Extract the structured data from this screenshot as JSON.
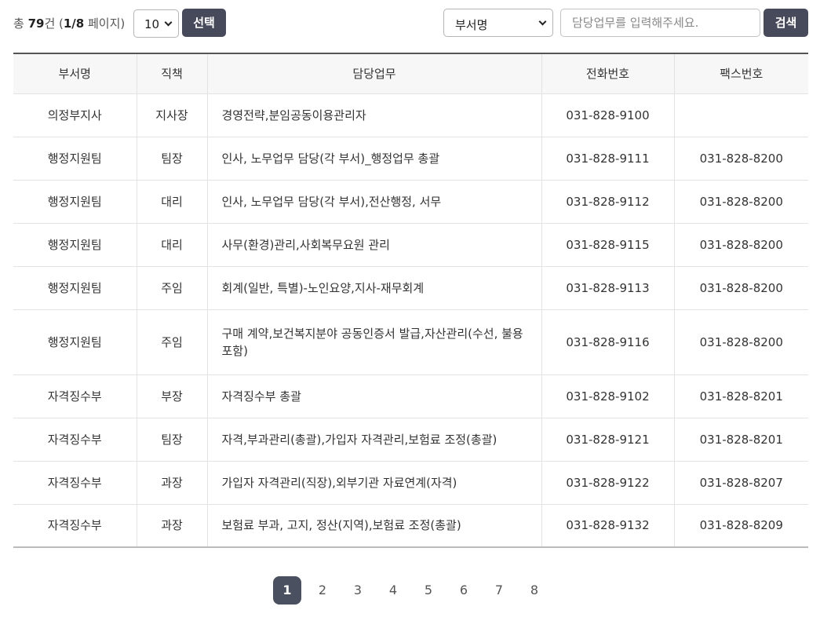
{
  "summary": {
    "prefix": "총 ",
    "total": "79",
    "unit": "건 (",
    "page": "1/8",
    "suffix": " 페이지)"
  },
  "page_size": {
    "value": "10"
  },
  "select_button": "선택",
  "dept_select": {
    "value": "부서명"
  },
  "search": {
    "placeholder": "담당업무를 입력해주세요.",
    "value": ""
  },
  "search_button": "검색",
  "table": {
    "headers": [
      "부서명",
      "직책",
      "담당업무",
      "전화번호",
      "팩스번호"
    ],
    "rows": [
      [
        "의정부지사",
        "지사장",
        "경영전략,분임공동이용관리자",
        "031-828-9100",
        ""
      ],
      [
        "행정지원팀",
        "팀장",
        "인사, 노무업무 담당(각 부서)_행정업무 총괄",
        "031-828-9111",
        "031-828-8200"
      ],
      [
        "행정지원팀",
        "대리",
        "인사, 노무업무 담당(각 부서),전산행정, 서무",
        "031-828-9112",
        "031-828-8200"
      ],
      [
        "행정지원팀",
        "대리",
        "사무(환경)관리,사회복무요원 관리",
        "031-828-9115",
        "031-828-8200"
      ],
      [
        "행정지원팀",
        "주임",
        "회계(일반, 특별)-노인요양,지사-재무회계",
        "031-828-9113",
        "031-828-8200"
      ],
      [
        "행정지원팀",
        "주임",
        "구매 계약,보건복지분야 공동인증서 발급,자산관리(수선, 불용 포함)",
        "031-828-9116",
        "031-828-8200"
      ],
      [
        "자격징수부",
        "부장",
        "자격징수부 총괄",
        "031-828-9102",
        "031-828-8201"
      ],
      [
        "자격징수부",
        "팀장",
        "자격,부과관리(총괄),가입자 자격관리,보험료 조정(총괄)",
        "031-828-9121",
        "031-828-8201"
      ],
      [
        "자격징수부",
        "과장",
        "가입자 자격관리(직장),외부기관 자료연계(자격)",
        "031-828-9122",
        "031-828-8207"
      ],
      [
        "자격징수부",
        "과장",
        "보험료 부과, 고지, 정산(지역),보험료 조정(총괄)",
        "031-828-9132",
        "031-828-8209"
      ]
    ]
  },
  "pagination": {
    "pages": [
      "1",
      "2",
      "3",
      "4",
      "5",
      "6",
      "7",
      "8"
    ],
    "current": "1"
  }
}
